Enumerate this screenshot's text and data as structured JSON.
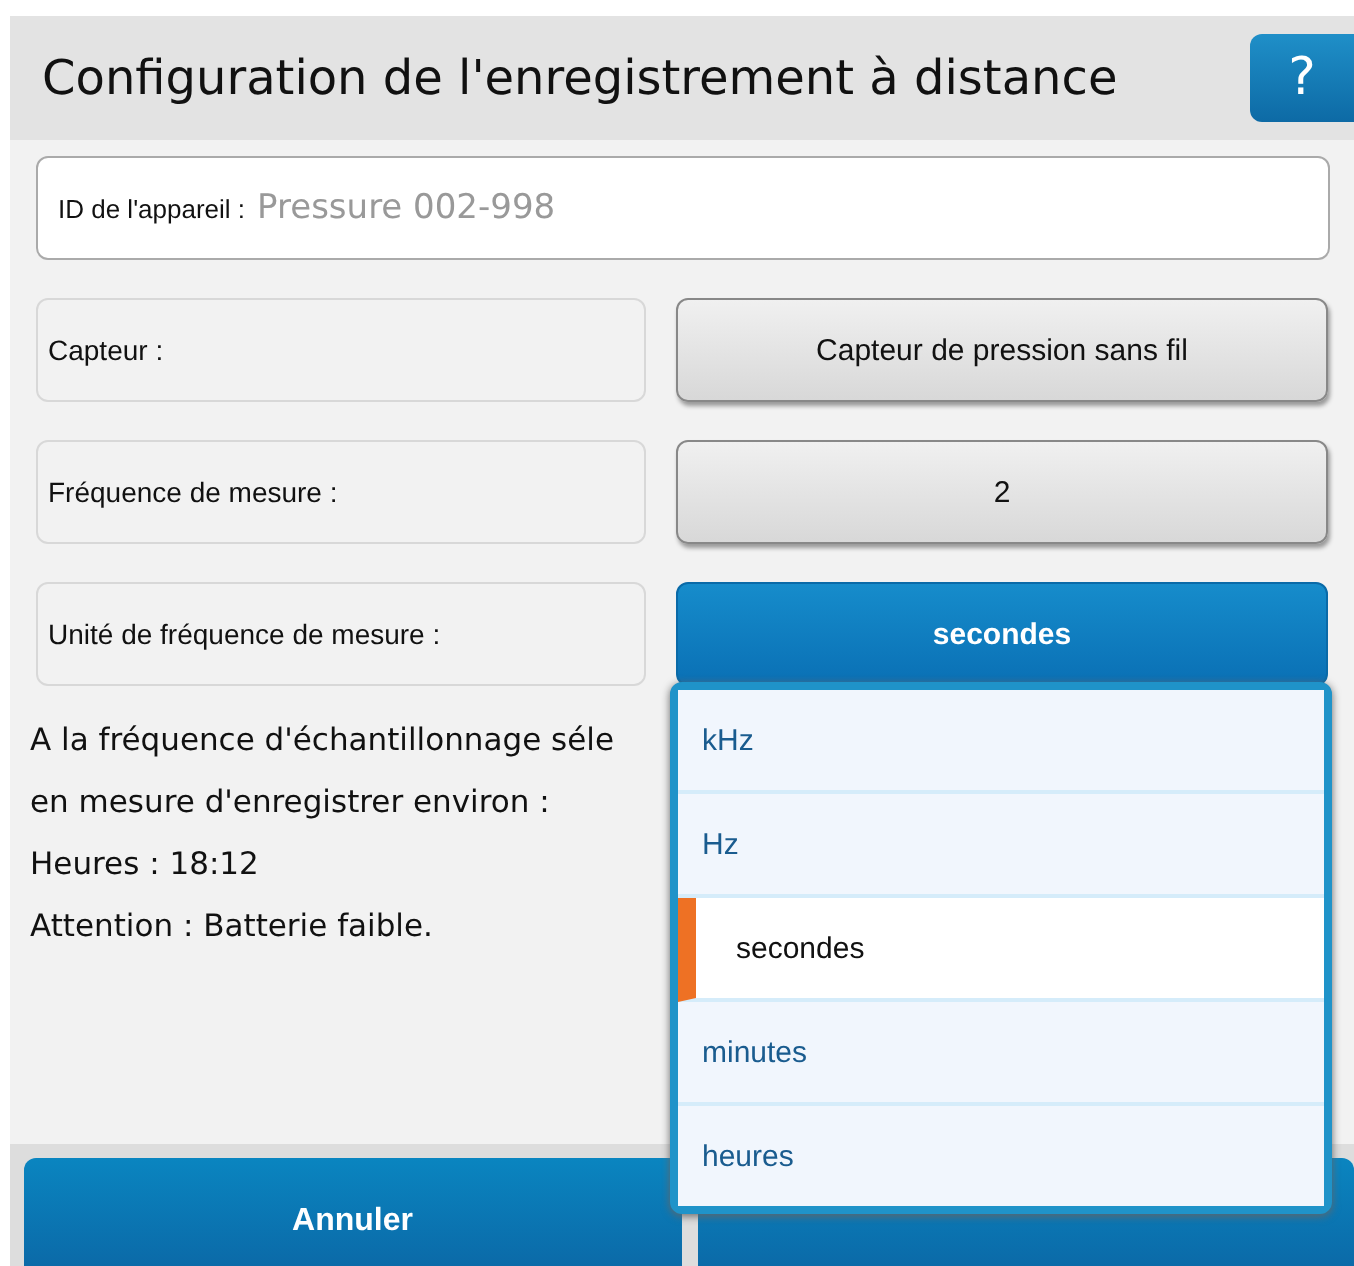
{
  "window": {
    "title": "Configuration de l'enregistrement à distance",
    "help": "?"
  },
  "device_id": {
    "label": "ID de l'appareil :",
    "placeholder": "Pressure 002-998"
  },
  "settings": [
    {
      "label": "Capteur :",
      "value": "Capteur de pression sans fil",
      "open": false
    },
    {
      "label": "Fréquence de mesure :",
      "value": "2",
      "open": false
    },
    {
      "label": "Unité de fréquence de mesure :",
      "value": "secondes",
      "open": true
    }
  ],
  "info_lines": [
    "A la fréquence d'échantillonnage séle",
    "en mesure d'enregistrer environ :",
    "Heures : 18:12",
    "Attention : Batterie faible."
  ],
  "dropdown": [
    {
      "label": "kHz",
      "selected": false
    },
    {
      "label": "Hz",
      "selected": false
    },
    {
      "label": "secondes",
      "selected": true
    },
    {
      "label": "minutes",
      "selected": false
    },
    {
      "label": "heures",
      "selected": false
    }
  ],
  "buttons": [
    "Annuler"
  ]
}
